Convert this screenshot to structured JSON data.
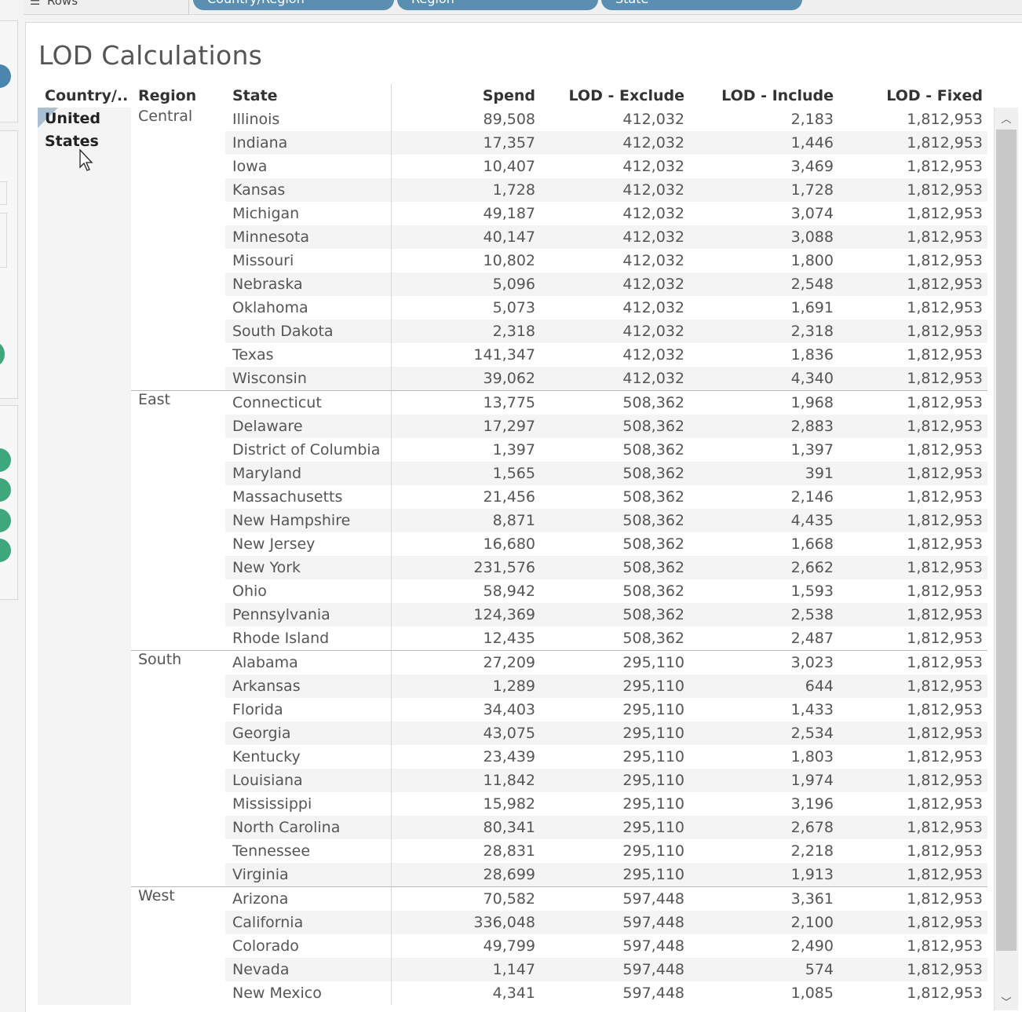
{
  "shelf": {
    "rows_label": "Rows",
    "pills": [
      "Country/Region",
      "Region",
      "State"
    ]
  },
  "title": "LOD Calculations",
  "columns": [
    "Country/..",
    "Region",
    "State",
    "Spend",
    "LOD - Exclude",
    "LOD - Include",
    "LOD - Fixed"
  ],
  "country": "United States",
  "groups": [
    {
      "region": "Central",
      "rows": [
        [
          "Illinois",
          "89,508",
          "412,032",
          "2,183",
          "1,812,953"
        ],
        [
          "Indiana",
          "17,357",
          "412,032",
          "1,446",
          "1,812,953"
        ],
        [
          "Iowa",
          "10,407",
          "412,032",
          "3,469",
          "1,812,953"
        ],
        [
          "Kansas",
          "1,728",
          "412,032",
          "1,728",
          "1,812,953"
        ],
        [
          "Michigan",
          "49,187",
          "412,032",
          "3,074",
          "1,812,953"
        ],
        [
          "Minnesota",
          "40,147",
          "412,032",
          "3,088",
          "1,812,953"
        ],
        [
          "Missouri",
          "10,802",
          "412,032",
          "1,800",
          "1,812,953"
        ],
        [
          "Nebraska",
          "5,096",
          "412,032",
          "2,548",
          "1,812,953"
        ],
        [
          "Oklahoma",
          "5,073",
          "412,032",
          "1,691",
          "1,812,953"
        ],
        [
          "South Dakota",
          "2,318",
          "412,032",
          "2,318",
          "1,812,953"
        ],
        [
          "Texas",
          "141,347",
          "412,032",
          "1,836",
          "1,812,953"
        ],
        [
          "Wisconsin",
          "39,062",
          "412,032",
          "4,340",
          "1,812,953"
        ]
      ]
    },
    {
      "region": "East",
      "rows": [
        [
          "Connecticut",
          "13,775",
          "508,362",
          "1,968",
          "1,812,953"
        ],
        [
          "Delaware",
          "17,297",
          "508,362",
          "2,883",
          "1,812,953"
        ],
        [
          "District of Columbia",
          "1,397",
          "508,362",
          "1,397",
          "1,812,953"
        ],
        [
          "Maryland",
          "1,565",
          "508,362",
          "391",
          "1,812,953"
        ],
        [
          "Massachusetts",
          "21,456",
          "508,362",
          "2,146",
          "1,812,953"
        ],
        [
          "New Hampshire",
          "8,871",
          "508,362",
          "4,435",
          "1,812,953"
        ],
        [
          "New Jersey",
          "16,680",
          "508,362",
          "1,668",
          "1,812,953"
        ],
        [
          "New York",
          "231,576",
          "508,362",
          "2,662",
          "1,812,953"
        ],
        [
          "Ohio",
          "58,942",
          "508,362",
          "1,593",
          "1,812,953"
        ],
        [
          "Pennsylvania",
          "124,369",
          "508,362",
          "2,538",
          "1,812,953"
        ],
        [
          "Rhode Island",
          "12,435",
          "508,362",
          "2,487",
          "1,812,953"
        ]
      ]
    },
    {
      "region": "South",
      "rows": [
        [
          "Alabama",
          "27,209",
          "295,110",
          "3,023",
          "1,812,953"
        ],
        [
          "Arkansas",
          "1,289",
          "295,110",
          "644",
          "1,812,953"
        ],
        [
          "Florida",
          "34,403",
          "295,110",
          "1,433",
          "1,812,953"
        ],
        [
          "Georgia",
          "43,075",
          "295,110",
          "2,534",
          "1,812,953"
        ],
        [
          "Kentucky",
          "23,439",
          "295,110",
          "1,803",
          "1,812,953"
        ],
        [
          "Louisiana",
          "11,842",
          "295,110",
          "1,974",
          "1,812,953"
        ],
        [
          "Mississippi",
          "15,982",
          "295,110",
          "3,196",
          "1,812,953"
        ],
        [
          "North Carolina",
          "80,341",
          "295,110",
          "2,678",
          "1,812,953"
        ],
        [
          "Tennessee",
          "28,831",
          "295,110",
          "2,218",
          "1,812,953"
        ],
        [
          "Virginia",
          "28,699",
          "295,110",
          "1,913",
          "1,812,953"
        ]
      ]
    },
    {
      "region": "West",
      "rows": [
        [
          "Arizona",
          "70,582",
          "597,448",
          "3,361",
          "1,812,953"
        ],
        [
          "California",
          "336,048",
          "597,448",
          "2,100",
          "1,812,953"
        ],
        [
          "Colorado",
          "49,799",
          "597,448",
          "2,490",
          "1,812,953"
        ],
        [
          "Nevada",
          "1,147",
          "597,448",
          "574",
          "1,812,953"
        ],
        [
          "New Mexico",
          "4,341",
          "597,448",
          "1,085",
          "1,812,953"
        ]
      ]
    }
  ],
  "scrollbar": {
    "up_icon": "chevron-up-icon",
    "down_icon": "chevron-down-icon"
  },
  "colors": {
    "pill": "#5b8fb1",
    "band": "#f4f4f4",
    "dot_blue": "#4a86ad",
    "dot_green": "#3ea77c"
  }
}
